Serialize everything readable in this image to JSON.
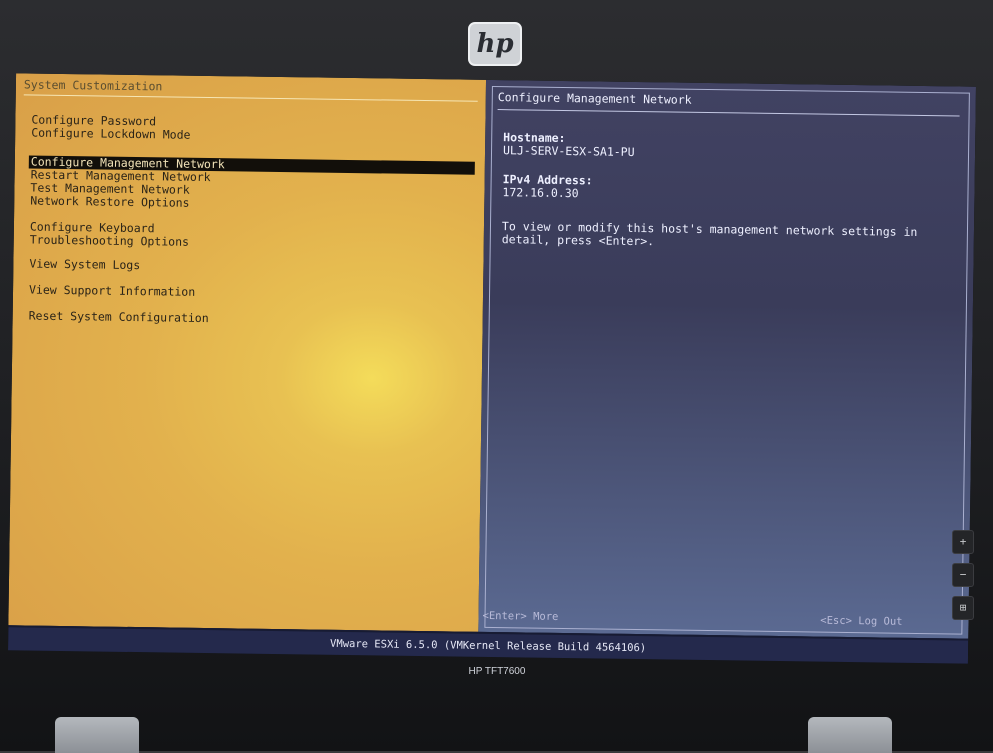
{
  "device": {
    "logo_text": "hp",
    "model": "HP TFT7600",
    "side_buttons": [
      "+",
      "−",
      "⊞"
    ]
  },
  "menu": {
    "title": "System Customization",
    "items": [
      {
        "label": "Configure Password"
      },
      {
        "label": "Configure Lockdown Mode"
      },
      {
        "label": "Configure Management Network",
        "selected": true
      },
      {
        "label": "Restart Management Network"
      },
      {
        "label": "Test Management Network"
      },
      {
        "label": "Network Restore Options"
      },
      {
        "label": "Configure Keyboard"
      },
      {
        "label": "Troubleshooting Options"
      },
      {
        "label": "View System Logs"
      },
      {
        "label": "View Support Information"
      },
      {
        "label": "Reset System Configuration"
      }
    ]
  },
  "detail": {
    "title": "Configure Management Network",
    "hostname_label": "Hostname:",
    "hostname_value": "ULJ-SERV-ESX-SA1-PU",
    "ipv4_label": "IPv4 Address:",
    "ipv4_value": "172.16.0.30",
    "description": "To view or modify this host's management network settings in detail, press <Enter>.",
    "enter_hint": "<Enter> More",
    "esc_hint": "<Esc> Log Out"
  },
  "status_bar": {
    "text": "VMware ESXi 6.5.0 (VMKernel Release Build 4564106)"
  },
  "colors": {
    "left_panel": "#e2b14d",
    "right_panel": "#3a3c5a",
    "selection": "#120f0a",
    "status_bar": "#24294c"
  }
}
